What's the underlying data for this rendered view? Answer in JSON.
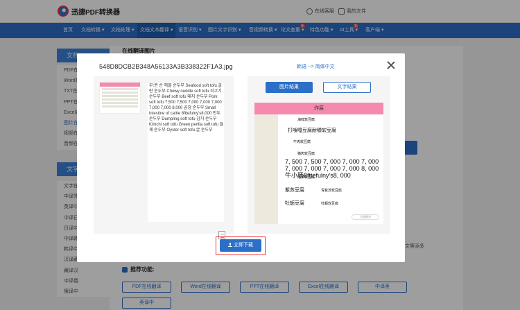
{
  "brand": {
    "name": "迅捷PDF转换器"
  },
  "header": {
    "links": [
      {
        "label": "在线客服",
        "icon": "headset-icon"
      },
      {
        "label": "我的文件",
        "icon": "file-icon"
      }
    ]
  },
  "nav": {
    "items": [
      {
        "label": "首页"
      },
      {
        "label": "文档转换 ▾"
      },
      {
        "label": "文档处理 ▾"
      },
      {
        "label": "文档文本翻译 ▾"
      },
      {
        "label": "语音识别 ▾"
      },
      {
        "label": "图片文字识别 ▾"
      },
      {
        "label": "音视频转换 ▾"
      },
      {
        "label": "论文查重 ▾"
      },
      {
        "label": "特色功能 ▾"
      },
      {
        "label": "AI工具 ▾"
      },
      {
        "label": "客户端 ▾"
      }
    ],
    "badges": [
      "新",
      "新"
    ]
  },
  "sidebar": {
    "group1": {
      "title": "文档",
      "items": [
        "PDF在",
        "Word在",
        "TXT在",
        "PPT在",
        "Excel在",
        "图片在",
        "视频在",
        "音频在"
      ]
    },
    "group2": {
      "title": "文字",
      "items": [
        "文字在",
        "中译外",
        "英译中",
        "中译日",
        "日译中",
        "中译韩",
        "韩译中",
        "汉译藏",
        "藏译汉",
        "中译俄",
        "俄译中"
      ]
    }
  },
  "main": {
    "title": "在线翻译图片",
    "note": "文等添多",
    "recommend": {
      "title": "推荐功能:",
      "buttons": [
        "PDF在线翻译",
        "Word在线翻译",
        "PPT在线翻译",
        "Excel在线翻译",
        "中译英",
        "英译中"
      ]
    }
  },
  "modal": {
    "filename": "548D8DCB2B348A56133A3B338322F1A3.jpg",
    "lang": "韩语 --> 简体中文",
    "tabs": {
      "image": "图片结果",
      "text": "文字结果"
    },
    "source_text": "부:권 순 해물 순두부 Seafood soft tofu 콜란 순두부 Chewy nuddle soft tofu 쇠고기 순두부 Beef soft tofu 돼지 순두부 Pork soft tofu 7,500 7,500 7,000 7,000 7,000 7,000 7,000 8,000 곱창 순두부 Small intestine of cattle 8fttefulny's8,000 만두 순두부 Dumpling soft tofu 김치 순두부 Kimchi soft tofu Green perilla soft tofu 들깨 순두부 Oyster soft tofu 굴 순두부",
    "result": {
      "header": "炸腐",
      "lines": [
        "海鲜软豆腐",
        "打嗖噻豆腐耐嚼软豆腐",
        "牛肉软豆腐",
        "猪肉软豆腐",
        "池菜软豆腐",
        "紫苏豆腐",
        "青紫苏软豆腐",
        "牡蛎豆腐",
        "牡蛎软豆腐"
      ],
      "big": "7, 500 7, 500 7, 000 7, 000 7, 000 7, 000 7, 000 7, 000 7, 000 8, 000牛小肠8fttefulny's8, 000",
      "watermark": "迅捷翻译"
    },
    "download": "立即下载"
  }
}
